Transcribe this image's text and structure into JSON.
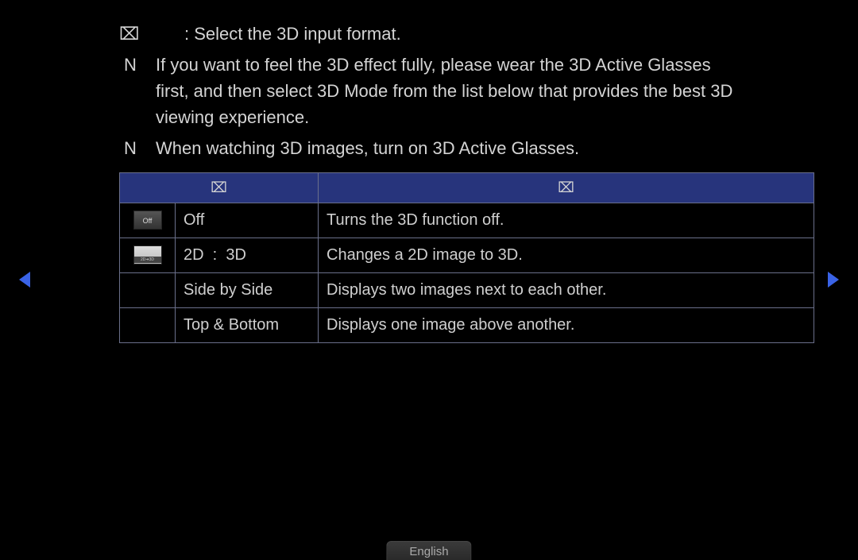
{
  "intro": {
    "glyph": "⌧",
    "text": ": Select the 3D input format."
  },
  "notes": [
    {
      "marker": "N",
      "text": "If you want to feel the 3D effect fully, please wear the 3D Active Glasses first, and then select 3D Mode from the list below that provides the best 3D viewing experience."
    },
    {
      "marker": "N",
      "text": "When watching 3D images, turn on 3D Active Glasses."
    }
  ],
  "table": {
    "headers": [
      "⌧",
      "⌧"
    ],
    "rows": [
      {
        "icon": {
          "type": "off",
          "label": "Off"
        },
        "mode": "Off",
        "desc": "Turns the 3D function off."
      },
      {
        "icon": {
          "type": "conv",
          "label": "2D➜3D"
        },
        "mode": "2D  :  3D",
        "desc": "Changes a 2D image to 3D."
      },
      {
        "icon": null,
        "mode": "Side by Side",
        "desc": "Displays two images next to each other."
      },
      {
        "icon": null,
        "mode": "Top & Bottom",
        "desc": "Displays one image above another."
      }
    ]
  },
  "language": "English",
  "colors": {
    "header_bg": "#27347c",
    "arrow": "#3a63e6"
  }
}
